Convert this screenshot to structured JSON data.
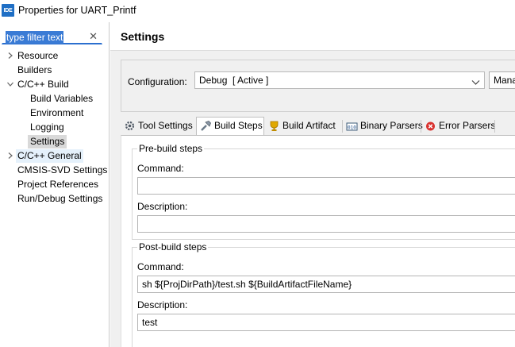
{
  "window": {
    "icon_label": "IDE",
    "title": "Properties for UART_Printf"
  },
  "filter": {
    "text": "type filter text"
  },
  "tree": {
    "items": [
      {
        "label": "Resource",
        "expandable": true,
        "expanded": false
      },
      {
        "label": "Builders"
      },
      {
        "label": "C/C++ Build",
        "expandable": true,
        "expanded": true
      },
      {
        "label": "Build Variables"
      },
      {
        "label": "Environment"
      },
      {
        "label": "Logging"
      },
      {
        "label": "Settings",
        "selected": true
      },
      {
        "label": "C/C++ General",
        "expandable": true,
        "expanded": false,
        "focused": true
      },
      {
        "label": "CMSIS-SVD Settings"
      },
      {
        "label": "Project References"
      },
      {
        "label": "Run/Debug Settings"
      }
    ]
  },
  "settings": {
    "title": "Settings",
    "configuration_label": "Configuration:",
    "configuration_value": "Debug  [ Active ]",
    "manage_label": "Mana"
  },
  "tabs": [
    {
      "label": "Tool Settings",
      "icon": "tool-settings-icon"
    },
    {
      "label": "Build Steps",
      "icon": "build-steps-icon",
      "active": true
    },
    {
      "label": "Build Artifact",
      "icon": "build-artifact-icon"
    },
    {
      "label": "Binary Parsers",
      "icon": "binary-parsers-icon"
    },
    {
      "label": "Error Parsers",
      "icon": "error-parsers-icon"
    }
  ],
  "prebuild": {
    "title": "Pre-build steps",
    "command_label": "Command:",
    "command_value": "",
    "description_label": "Description:",
    "description_value": ""
  },
  "postbuild": {
    "title": "Post-build steps",
    "command_label": "Command:",
    "command_value": "sh ${ProjDirPath}/test.sh ${BuildArtifactFileName}",
    "description_label": "Description:",
    "description_value": "test"
  },
  "colors": {
    "selection_blue": "#3a7bd5",
    "selected_item": "#d9d9d9",
    "focused_item": "#e5f1fb"
  }
}
